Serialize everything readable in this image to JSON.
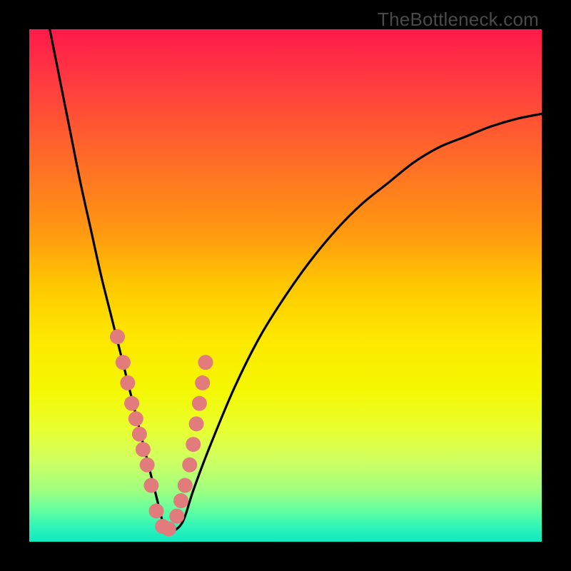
{
  "watermark": "TheBottleneck.com",
  "chart_data": {
    "type": "line",
    "title": "",
    "xlabel": "",
    "ylabel": "",
    "xlim": [
      0,
      100
    ],
    "ylim": [
      0,
      100
    ],
    "curve": {
      "name": "bottleneck-curve",
      "x": [
        4,
        6,
        8,
        10,
        12,
        14,
        16,
        18,
        20,
        22,
        23,
        24,
        25,
        26,
        27,
        28,
        30,
        32,
        35,
        40,
        45,
        50,
        55,
        60,
        65,
        70,
        75,
        80,
        85,
        90,
        95,
        100
      ],
      "y": [
        100,
        90,
        80,
        70,
        61,
        52,
        44,
        36,
        28,
        20,
        16,
        12,
        8,
        4,
        2,
        2,
        4,
        10,
        18,
        30,
        40,
        48,
        55,
        61,
        66,
        70,
        74,
        77,
        79,
        81,
        82.5,
        83.5
      ]
    },
    "dots": {
      "name": "sample-points",
      "x": [
        17.2,
        18.3,
        19.2,
        20.0,
        20.8,
        21.5,
        22.2,
        23.0,
        23.8,
        24.8,
        26.0,
        27.2,
        28.8,
        29.6,
        30.4,
        31.3,
        32.0,
        32.6,
        33.2,
        33.8,
        34.4
      ],
      "y": [
        40,
        35,
        31,
        27,
        24,
        21,
        18,
        15,
        11,
        6,
        3,
        2.5,
        5,
        8,
        11,
        15,
        19,
        23,
        27,
        31,
        35
      ]
    },
    "gradient_stops": [
      {
        "pos": 0,
        "color": "#ff1a4a"
      },
      {
        "pos": 50,
        "color": "#ffc800"
      },
      {
        "pos": 80,
        "color": "#e8ff30"
      },
      {
        "pos": 100,
        "color": "#10e8c0"
      }
    ]
  }
}
